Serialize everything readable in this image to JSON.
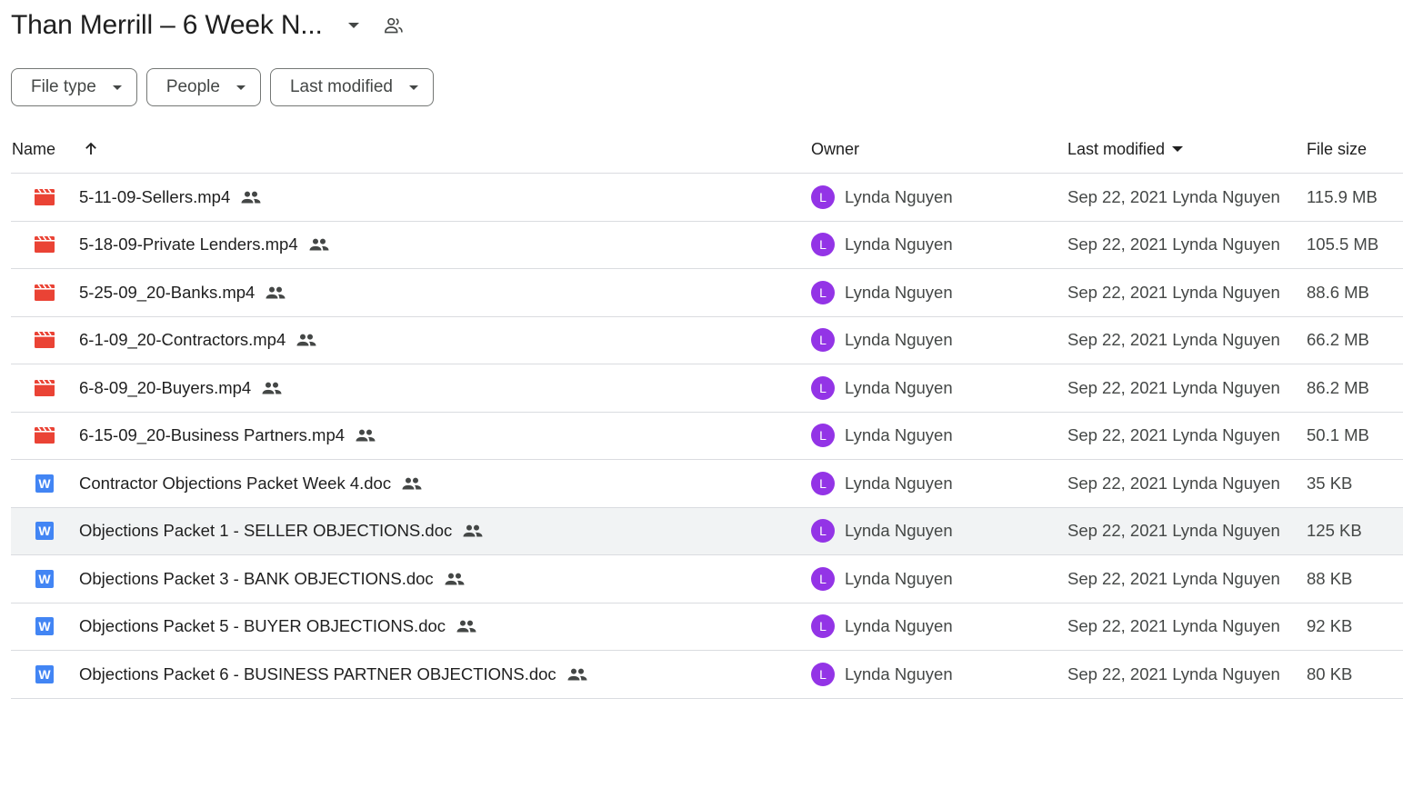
{
  "header": {
    "title": "Than Merrill – 6 Week N...",
    "title_icon": "chevron-down-icon",
    "share_icon": "people-outline-icon"
  },
  "filters": [
    {
      "label": "File type"
    },
    {
      "label": "People"
    },
    {
      "label": "Last modified"
    }
  ],
  "columns": {
    "name": "Name",
    "owner": "Owner",
    "modified": "Last modified",
    "size": "File size"
  },
  "colors": {
    "video_icon": "#ea4335",
    "doc_icon": "#4285f4",
    "avatar": "#9334e6",
    "selected_row": "#f1f3f4"
  },
  "files": [
    {
      "name": "5-11-09-Sellers.mp4",
      "type": "video",
      "owner_initial": "L",
      "owner": "Lynda Nguyen",
      "modified": "Sep 22, 2021 Lynda Nguyen",
      "size": "115.9 MB"
    },
    {
      "name": "5-18-09-Private Lenders.mp4",
      "type": "video",
      "owner_initial": "L",
      "owner": "Lynda Nguyen",
      "modified": "Sep 22, 2021 Lynda Nguyen",
      "size": "105.5 MB"
    },
    {
      "name": "5-25-09_20-Banks.mp4",
      "type": "video",
      "owner_initial": "L",
      "owner": "Lynda Nguyen",
      "modified": "Sep 22, 2021 Lynda Nguyen",
      "size": "88.6 MB"
    },
    {
      "name": "6-1-09_20-Contractors.mp4",
      "type": "video",
      "owner_initial": "L",
      "owner": "Lynda Nguyen",
      "modified": "Sep 22, 2021 Lynda Nguyen",
      "size": "66.2 MB"
    },
    {
      "name": "6-8-09_20-Buyers.mp4",
      "type": "video",
      "owner_initial": "L",
      "owner": "Lynda Nguyen",
      "modified": "Sep 22, 2021 Lynda Nguyen",
      "size": "86.2 MB"
    },
    {
      "name": "6-15-09_20-Business Partners.mp4",
      "type": "video",
      "owner_initial": "L",
      "owner": "Lynda Nguyen",
      "modified": "Sep 22, 2021 Lynda Nguyen",
      "size": "50.1 MB"
    },
    {
      "name": "Contractor Objections Packet Week 4.doc",
      "type": "doc",
      "doc_letter": "W",
      "owner_initial": "L",
      "owner": "Lynda Nguyen",
      "modified": "Sep 22, 2021 Lynda Nguyen",
      "size": "35 KB"
    },
    {
      "name": "Objections Packet 1 - SELLER OBJECTIONS.doc",
      "type": "doc",
      "doc_letter": "W",
      "owner_initial": "L",
      "owner": "Lynda Nguyen",
      "modified": "Sep 22, 2021 Lynda Nguyen",
      "size": "125 KB",
      "selected": true
    },
    {
      "name": "Objections Packet 3 - BANK OBJECTIONS.doc",
      "type": "doc",
      "doc_letter": "W",
      "owner_initial": "L",
      "owner": "Lynda Nguyen",
      "modified": "Sep 22, 2021 Lynda Nguyen",
      "size": "88 KB"
    },
    {
      "name": "Objections Packet 5 - BUYER OBJECTIONS.doc",
      "type": "doc",
      "doc_letter": "W",
      "owner_initial": "L",
      "owner": "Lynda Nguyen",
      "modified": "Sep 22, 2021 Lynda Nguyen",
      "size": "92 KB"
    },
    {
      "name": "Objections Packet 6 - BUSINESS PARTNER OBJECTIONS.doc",
      "type": "doc",
      "doc_letter": "W",
      "owner_initial": "L",
      "owner": "Lynda Nguyen",
      "modified": "Sep 22, 2021 Lynda Nguyen",
      "size": "80 KB"
    }
  ]
}
